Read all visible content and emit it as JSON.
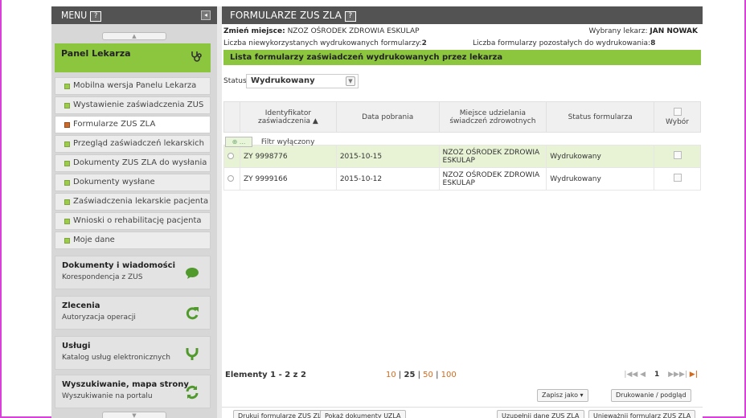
{
  "menu": {
    "title": "MENU",
    "help": "?",
    "collapse": "◂",
    "scroll_up": "▲",
    "scroll_down": "▼"
  },
  "panel": {
    "title": "Panel Lekarza",
    "icon": "stethoscope-icon"
  },
  "sidebar_items": [
    {
      "label": "Mobilna wersja Panelu Lekarza"
    },
    {
      "label": "Wystawienie zaświadczenia ZUS ZLA"
    },
    {
      "label": "Formularze ZUS ZLA"
    },
    {
      "label": "Przegląd zaświadczeń lekarskich"
    },
    {
      "label": "Dokumenty ZUS ZLA do wysłania"
    },
    {
      "label": "Dokumenty wysłane"
    },
    {
      "label": "Zaświadczenia lekarskie pacjenta"
    },
    {
      "label": "Wnioski o rehabilitację pacjenta"
    },
    {
      "label": "Moje dane"
    }
  ],
  "groups": [
    {
      "title": "Dokumenty i wiadomości",
      "subtitle": "Korespondencja z ZUS",
      "icon": "speech-bubble-icon",
      "glyph": "●"
    },
    {
      "title": "Zlecenia",
      "subtitle": "Autoryzacja operacji",
      "icon": "refresh-icon",
      "glyph": "↻"
    },
    {
      "title": "Usługi",
      "subtitle": "Katalog usług elektronicznych",
      "icon": "fork-icon",
      "glyph": "Ⴘ"
    },
    {
      "title": "Wyszukiwanie, mapa strony",
      "subtitle": "Wyszukiwanie na portalu",
      "icon": "sync-icon",
      "glyph": "⟳"
    }
  ],
  "header": {
    "title": "FORMULARZE ZUS ZLA",
    "help": "?"
  },
  "info": {
    "change_place_label": "Zmień miejsce:",
    "place": "NZOZ OŚRODEK ZDROWIA ESKULAP",
    "doctor_label": "Wybrany lekarz:",
    "doctor": "JAN NOWAK",
    "unused_label": "Liczba niewykorzystanych wydrukowanych formularzy:",
    "unused": "2",
    "remaining_label": "Liczba formularzy pozostałych do wydrukowania:",
    "remaining": "8"
  },
  "list_title": "Lista formularzy zaświadczeń wydrukowanych przez lekarza",
  "status": {
    "label": "Status",
    "value": "Wydrukowany"
  },
  "columns": {
    "id": "Identyfikator zaświadczenia",
    "date": "Data pobrania",
    "place": "Miejsce udzielania świadczeń zdrowotnych",
    "status": "Status formularza",
    "choose": "Wybór"
  },
  "filter": {
    "btn": "⊕ ...",
    "text": "Filtr wyłączony"
  },
  "rows": [
    {
      "id": "ZY 9998776",
      "date": "2015-10-15",
      "place": "NZOZ OŚRODEK ZDROWIA ESKULAP",
      "status": "Wydrukowany"
    },
    {
      "id": "ZY 9999166",
      "date": "2015-10-12",
      "place": "NZOZ OŚRODEK ZDROWIA ESKULAP",
      "status": "Wydrukowany"
    }
  ],
  "pager": {
    "elements": "Elementy 1 - 2 z 2",
    "size10": "10",
    "size25": "25",
    "size50": "50",
    "size100": "100",
    "sep": "|",
    "first": "|◀◀",
    "prev": "◀",
    "page": "1",
    "next": "▶",
    "nextnext": "▶▶|",
    "last": "▶|"
  },
  "buttons": {
    "save_as": "Zapisz jako",
    "save_as_dd": "▾",
    "print_preview": "Drukowanie / podgląd",
    "print_forms": "Drukuj formularze ZUS ZLA",
    "show_docs": "Pokaż dokumenty UZLA",
    "complete": "Uzupełnij dane ZUS ZLA",
    "cancel_form": "Unieważnij formularz ZUS ZLA"
  }
}
